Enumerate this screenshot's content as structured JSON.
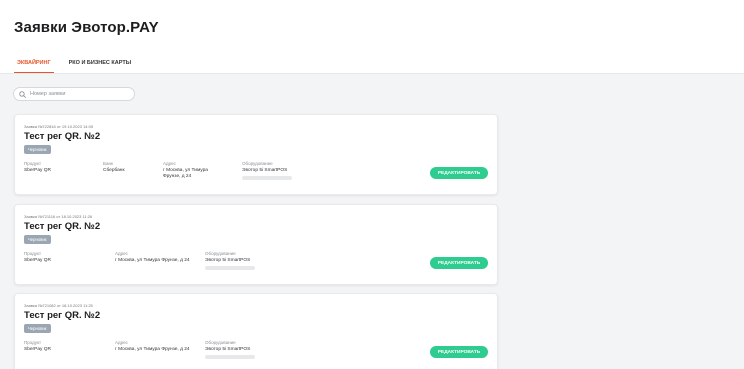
{
  "page": {
    "title": "Заявки Эвотор.PAY"
  },
  "tabs": [
    {
      "label": "ЭКВАЙРИНГ",
      "active": true
    },
    {
      "label": "РКО И БИЗНЕС КАРТЫ",
      "active": false
    }
  ],
  "search": {
    "placeholder": "Номер заявки",
    "icon": "search-icon"
  },
  "colors": {
    "accent": "#e8552b",
    "button": "#2ecc8f",
    "badge": "#9aa7b2",
    "background": "#f3f4f6"
  },
  "cards": [
    {
      "meta": "Заявка №722816 от 19.10.2023 14:05",
      "title": "Тест рег QR. №2",
      "status": "Черновик",
      "fields": {
        "product_label": "Продукт",
        "product": "SberPay QR",
        "bank_label": "Банк",
        "bank": "Сбербанк",
        "address_label": "Адрес",
        "address": "г Москва, ул Тимура Фрунзе, д 24",
        "equipment_label": "Оборудование",
        "equipment": "Эвотор 5i SmartPOS"
      },
      "edit_label": "РЕДАКТИРОВАТЬ"
    },
    {
      "meta": "Заявка №721116 от 18.10.2023 11:26",
      "title": "Тест рег QR. №2",
      "status": "Черновик",
      "fields": {
        "product_label": "Продукт",
        "product": "SberPay QR",
        "address_label": "Адрес",
        "address": "г Москва, ул Тимура Фрунзе, д 24",
        "equipment_label": "Оборудование",
        "equipment": "Эвотор 5i SmartPOS"
      },
      "edit_label": "РЕДАКТИРОВАТЬ"
    },
    {
      "meta": "Заявка №721082 от 18.10.2023 11:25",
      "title": "Тест рег QR. №2",
      "status": "Черновик",
      "fields": {
        "product_label": "Продукт",
        "product": "SberPay QR",
        "address_label": "Адрес",
        "address": "г Москва, ул Тимура Фрунзе, д 24",
        "equipment_label": "Оборудование",
        "equipment": "Эвотор 5i SmartPOS"
      },
      "edit_label": "РЕДАКТИРОВАТЬ"
    }
  ]
}
